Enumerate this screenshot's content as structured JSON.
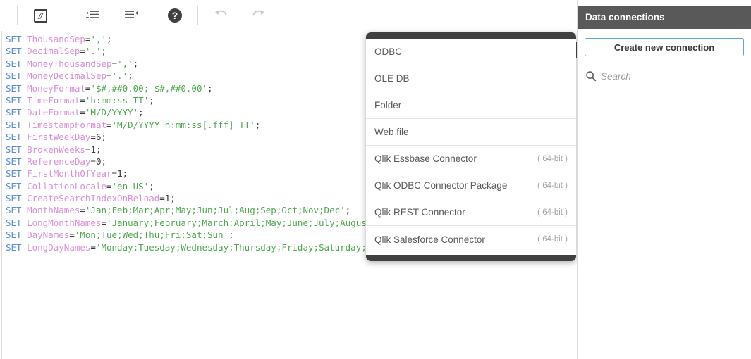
{
  "toolbar": {
    "comment_icon": "comment-icon",
    "comment_glyph": "//",
    "indent_icon": "indent-increase-icon",
    "outdent_icon": "indent-decrease-icon",
    "help_icon": "help-icon",
    "help_glyph": "?",
    "undo_icon": "undo-icon",
    "redo_icon": "redo-icon"
  },
  "editor": {
    "lines": [
      {
        "kw": "SET",
        "var": "ThousandSep",
        "op": "=",
        "val": "','",
        "type": "str",
        "end": ";"
      },
      {
        "kw": "SET",
        "var": "DecimalSep",
        "op": "=",
        "val": "'.'",
        "type": "str",
        "end": ";"
      },
      {
        "kw": "SET",
        "var": "MoneyThousandSep",
        "op": "=",
        "val": "','",
        "type": "str",
        "end": ";"
      },
      {
        "kw": "SET",
        "var": "MoneyDecimalSep",
        "op": "=",
        "val": "'.'",
        "type": "str",
        "end": ";"
      },
      {
        "kw": "SET",
        "var": "MoneyFormat",
        "op": "=",
        "val": "'$#,##0.00;-$#,##0.00'",
        "type": "str",
        "end": ";"
      },
      {
        "kw": "SET",
        "var": "TimeFormat",
        "op": "=",
        "val": "'h:mm:ss TT'",
        "type": "str",
        "end": ";"
      },
      {
        "kw": "SET",
        "var": "DateFormat",
        "op": "=",
        "val": "'M/D/YYYY'",
        "type": "str",
        "end": ";"
      },
      {
        "kw": "SET",
        "var": "TimestampFormat",
        "op": "=",
        "val": "'M/D/YYYY h:mm:ss[.fff] TT'",
        "type": "str",
        "end": ";"
      },
      {
        "kw": "SET",
        "var": "FirstWeekDay",
        "op": "=",
        "val": "6",
        "type": "num",
        "end": ";"
      },
      {
        "kw": "SET",
        "var": "BrokenWeeks",
        "op": "=",
        "val": "1",
        "type": "num",
        "end": ";"
      },
      {
        "kw": "SET",
        "var": "ReferenceDay",
        "op": "=",
        "val": "0",
        "type": "num",
        "end": ";"
      },
      {
        "kw": "SET",
        "var": "FirstMonthOfYear",
        "op": "=",
        "val": "1",
        "type": "num",
        "end": ";"
      },
      {
        "kw": "SET",
        "var": "CollationLocale",
        "op": "=",
        "val": "'en-US'",
        "type": "str",
        "end": ";"
      },
      {
        "kw": "SET",
        "var": "CreateSearchIndexOnReload",
        "op": "=",
        "val": "1",
        "type": "num",
        "end": ";"
      },
      {
        "kw": "SET",
        "var": "MonthNames",
        "op": "=",
        "val": "'Jan;Feb;Mar;Apr;May;Jun;Jul;Aug;Sep;Oct;Nov;Dec'",
        "type": "str",
        "end": ";"
      },
      {
        "kw": "SET",
        "var": "LongMonthNames",
        "op": "=",
        "val": "'January;February;March;April;May;June;July;August;September;October;November;December'",
        "type": "str",
        "end": ";"
      },
      {
        "kw": "SET",
        "var": "DayNames",
        "op": "=",
        "val": "'Mon;Tue;Wed;Thu;Fri;Sat;Sun'",
        "type": "str",
        "end": ";"
      },
      {
        "kw": "SET",
        "var": "LongDayNames",
        "op": "=",
        "val": "'Monday;Tuesday;Wednesday;Thursday;Friday;Saturday;Sunday'",
        "type": "str",
        "end": ";"
      }
    ]
  },
  "popup": {
    "items": [
      {
        "label": "ODBC",
        "meta": ""
      },
      {
        "label": "OLE DB",
        "meta": ""
      },
      {
        "label": "Folder",
        "meta": ""
      },
      {
        "label": "Web file",
        "meta": ""
      },
      {
        "label": "Qlik Essbase Connector",
        "meta": "( 64-bit )"
      },
      {
        "label": "Qlik ODBC Connector Package",
        "meta": "( 64-bit )"
      },
      {
        "label": "Qlik REST Connector",
        "meta": "( 64-bit )"
      },
      {
        "label": "Qlik Salesforce Connector",
        "meta": "( 64-bit )"
      }
    ]
  },
  "right_panel": {
    "header_title": "Data connections",
    "create_button_label": "Create new connection",
    "search_placeholder": "Search",
    "search_value": "",
    "search_icon": "search-icon"
  },
  "colors": {
    "header_bg": "#595959",
    "popup_frame": "#404040",
    "accent_border": "#5fa8d3",
    "code_keyword": "#5b8dd6",
    "code_variable": "#d98fd9",
    "code_string": "#4fa84f"
  }
}
